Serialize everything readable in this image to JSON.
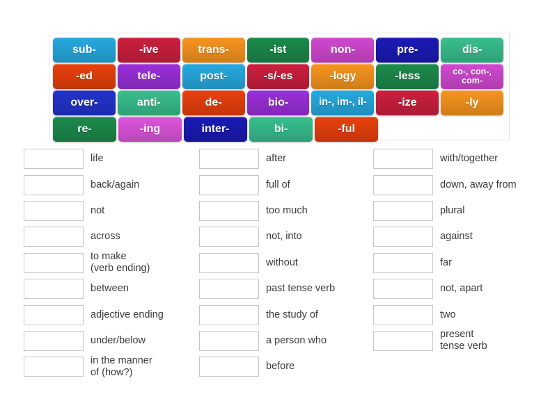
{
  "tile_bank": {
    "name": "word-part-tiles",
    "rows": [
      [
        {
          "label": "sub-",
          "color": "#26a9e0"
        },
        {
          "label": "-ive",
          "color": "#cc1f3f"
        },
        {
          "label": "trans-",
          "color": "#f7941e"
        },
        {
          "label": "-ist",
          "color": "#1c8a4c"
        },
        {
          "label": "non-",
          "color": "#d148d1"
        },
        {
          "label": "pre-",
          "color": "#1a1ab5"
        },
        {
          "label": "dis-",
          "color": "#38bf8e"
        }
      ],
      [
        {
          "label": "-ed",
          "color": "#e8400c"
        },
        {
          "label": "tele-",
          "color": "#9b2fd9"
        },
        {
          "label": "post-",
          "color": "#26a9e0"
        },
        {
          "label": "-s/-es",
          "color": "#cc1f3f"
        },
        {
          "label": "-logy",
          "color": "#f7941e"
        },
        {
          "label": "-less",
          "color": "#1c8a4c"
        },
        {
          "label": "co-, con-,\ncom-",
          "color": "#d148d1",
          "size": "small"
        }
      ],
      [
        {
          "label": "over-",
          "color": "#2233cc"
        },
        {
          "label": "anti-",
          "color": "#38bf8e"
        },
        {
          "label": "de-",
          "color": "#e8400c"
        },
        {
          "label": "bio-",
          "color": "#9b2fd9"
        },
        {
          "label": "in-, im-, il-",
          "color": "#26a9e0",
          "size": "fit"
        },
        {
          "label": "-ize",
          "color": "#cc1f3f"
        },
        {
          "label": "-ly",
          "color": "#f7941e"
        }
      ],
      [
        {
          "label": "re-",
          "color": "#1c8a4c"
        },
        {
          "label": "-ing",
          "color": "#dd55dd"
        },
        {
          "label": "inter-",
          "color": "#1a1ab5"
        },
        {
          "label": "bi-",
          "color": "#38bf8e"
        },
        {
          "label": "-ful",
          "color": "#e8400c"
        }
      ]
    ]
  },
  "answers": {
    "columns": [
      {
        "name": "answer-column-1",
        "rows": [
          {
            "label": "life"
          },
          {
            "label": "back/again"
          },
          {
            "label": "not"
          },
          {
            "label": "across"
          },
          {
            "label": "to make\n(verb ending)"
          },
          {
            "label": "between"
          },
          {
            "label": "adjective ending"
          },
          {
            "label": "under/below"
          },
          {
            "label": "in the manner\nof (how?)"
          }
        ]
      },
      {
        "name": "answer-column-2",
        "rows": [
          {
            "label": "after"
          },
          {
            "label": "full of"
          },
          {
            "label": "too much"
          },
          {
            "label": "not, into"
          },
          {
            "label": "without"
          },
          {
            "label": "past tense verb"
          },
          {
            "label": "the study of"
          },
          {
            "label": "a person who"
          },
          {
            "label": "before"
          }
        ]
      },
      {
        "name": "answer-column-3",
        "rows": [
          {
            "label": "with/together"
          },
          {
            "label": "down, away from"
          },
          {
            "label": "plural"
          },
          {
            "label": "against"
          },
          {
            "label": "far"
          },
          {
            "label": "not, apart"
          },
          {
            "label": "two"
          },
          {
            "label": "present\ntense verb"
          }
        ]
      }
    ]
  },
  "colors": {
    "panel_border": "#e3e3e3",
    "box_border": "#c6c6c6",
    "text": "#3a3a3a",
    "background": "#ffffff"
  }
}
